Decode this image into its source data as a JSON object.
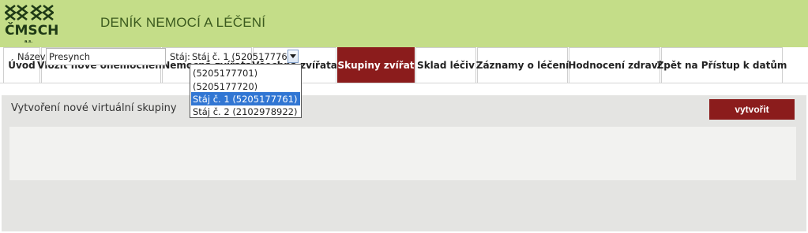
{
  "header": {
    "logo_text": "ČMSCH",
    "logo_sub": "a.s.",
    "app_title": "DENÍK NEMOCÍ A LÉČENÍ",
    "colors": {
      "header_bg": "#c4dd88",
      "logo_color": "#1f3a16"
    }
  },
  "nav": {
    "tabs": [
      {
        "label": "Úvod",
        "active": false
      },
      {
        "label": "Vložit nové onemocnění",
        "active": false
      },
      {
        "label": "Nemocná zvířata",
        "active": false
      },
      {
        "label": "Všechna zvířata",
        "active": false
      },
      {
        "label": "Skupiny zvířat",
        "active": true
      },
      {
        "label": "Sklad léčiv",
        "active": false
      },
      {
        "label": "Záznamy o léčení",
        "active": false
      },
      {
        "label": "Hodnocení zdraví",
        "active": false
      },
      {
        "label": "Zpět na Přístup k datům",
        "active": false
      }
    ],
    "colors": {
      "active_bg": "#8b1c1c",
      "active_text": "#ffffff"
    }
  },
  "form": {
    "title": "Vytvoření nové virtuální skupiny",
    "name_label": "Název:",
    "name_value": "Presynch",
    "stable_label": "Stáj:",
    "stable_selected": "Stáj č. 1 (5205177761)",
    "stable_options": [
      {
        "label": "(5205177701)",
        "selected": false
      },
      {
        "label": "(5205177720)",
        "selected": false
      },
      {
        "label": "Stáj č. 1 (5205177761)",
        "selected": true
      },
      {
        "label": "Stáj č. 2 (2102978922)",
        "selected": false
      }
    ],
    "create_label": "vytvořit",
    "colors": {
      "button_bg": "#8b1c1c",
      "selection_bg": "#3176d3"
    }
  }
}
